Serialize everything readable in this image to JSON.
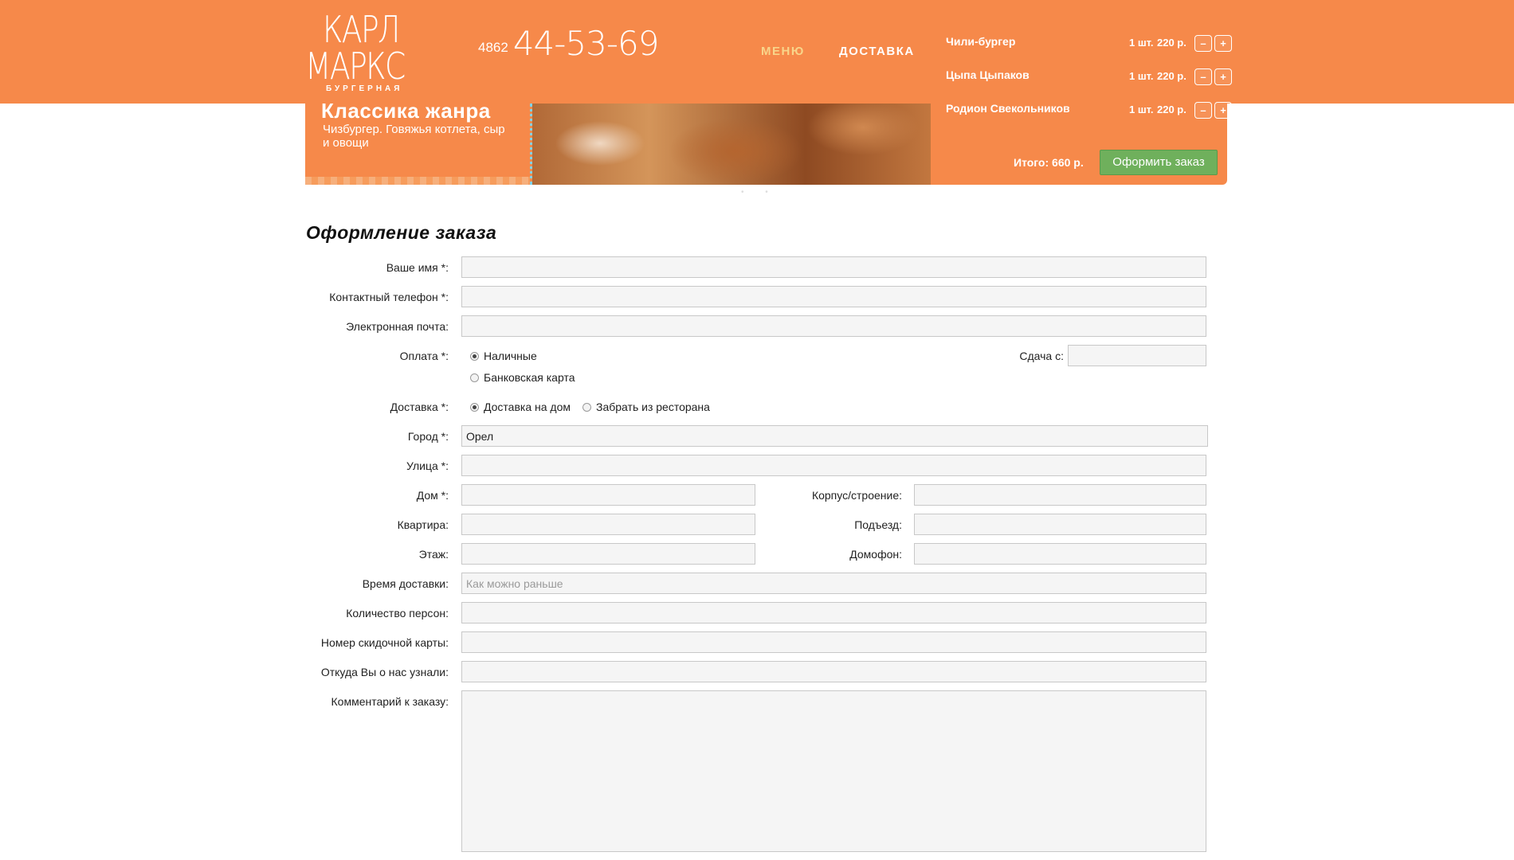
{
  "header": {
    "logo": {
      "line1": "КАРЛ",
      "line2": "МАРКС",
      "tagline": "БУРГЕРНАЯ"
    },
    "phone": {
      "code": "4862",
      "number": "44-53-69"
    },
    "nav": {
      "menu": "МЕНЮ",
      "delivery": "ДОСТАВКА"
    }
  },
  "cart": {
    "items": [
      {
        "name": "Чили-бургер",
        "qty": "1 шт.",
        "price": "220 р."
      },
      {
        "name": "Цыпа Цыпаков",
        "qty": "1 шт.",
        "price": "220 р."
      },
      {
        "name": "Родион Свекольников",
        "qty": "1 шт.",
        "price": "220 р."
      }
    ],
    "minus_label": "–",
    "plus_label": "+",
    "total": "Итого: 660 р.",
    "checkout_label": "Оформить заказ"
  },
  "banner": {
    "title": "Классика жанра",
    "subtitle": "Чизбургер. Говяжья котлета, сыр и овощи"
  },
  "form": {
    "title": "Оформление заказа",
    "name_label": "Ваше имя *:",
    "phone_label": "Контактный телефон *:",
    "email_label": "Электронная почта:",
    "payment_label": "Оплата *:",
    "payment_options": [
      "Наличные",
      "Банковская карта"
    ],
    "change_label": "Сдача с:",
    "delivery_label": "Доставка *:",
    "delivery_options": [
      "Доставка на дом",
      "Забрать из ресторана"
    ],
    "city_label": "Город *:",
    "city_value": "Орел",
    "street_label": "Улица *:",
    "house_label": "Дом *:",
    "building_label": "Корпус/строение:",
    "apartment_label": "Квартира:",
    "entrance_label": "Подъезд:",
    "floor_label": "Этаж:",
    "intercom_label": "Домофон:",
    "time_label": "Время доставки:",
    "time_placeholder": "Как можно раньше",
    "persons_label": "Количество персон:",
    "card_label": "Номер скидочной карты:",
    "source_label": "Откуда Вы о нас узнали:",
    "comment_label": "Комментарий к заказу:"
  }
}
